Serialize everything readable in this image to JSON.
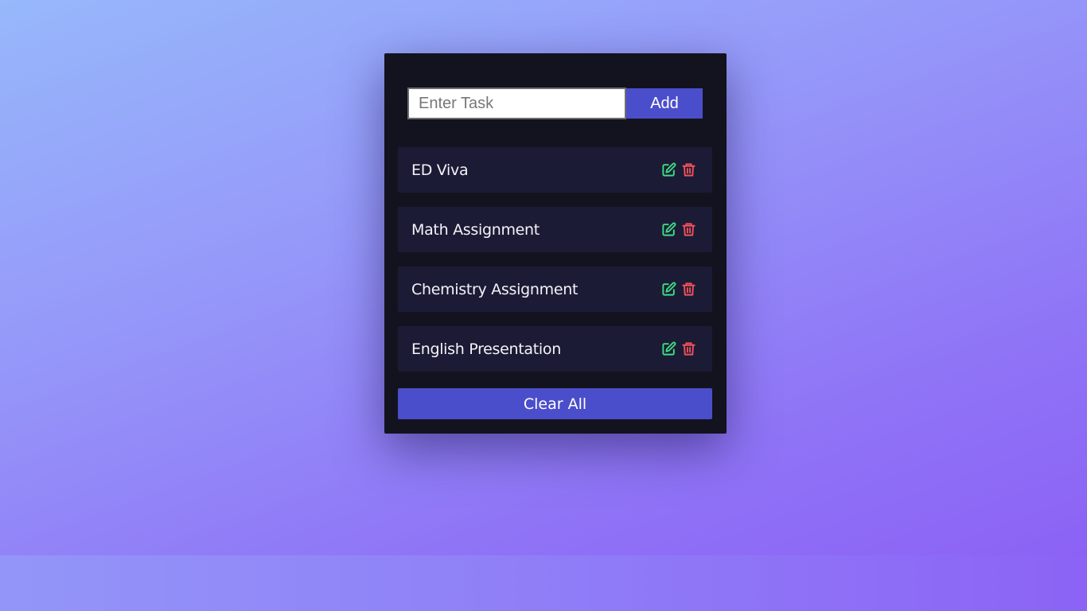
{
  "input": {
    "placeholder": "Enter Task",
    "value": ""
  },
  "add_button_label": "Add",
  "tasks": [
    {
      "label": "ED Viva"
    },
    {
      "label": "Math Assignment"
    },
    {
      "label": "Chemistry Assignment"
    },
    {
      "label": "English Presentation"
    }
  ],
  "icons": {
    "edit": "edit-icon",
    "delete": "trash-icon"
  },
  "clear_button_label": "Clear All",
  "colors": {
    "accent": "#4b4ecb",
    "card": "#13131f",
    "task_bg": "#1c1b36",
    "edit_icon": "#3ddc84",
    "delete_icon": "#f0515a"
  }
}
